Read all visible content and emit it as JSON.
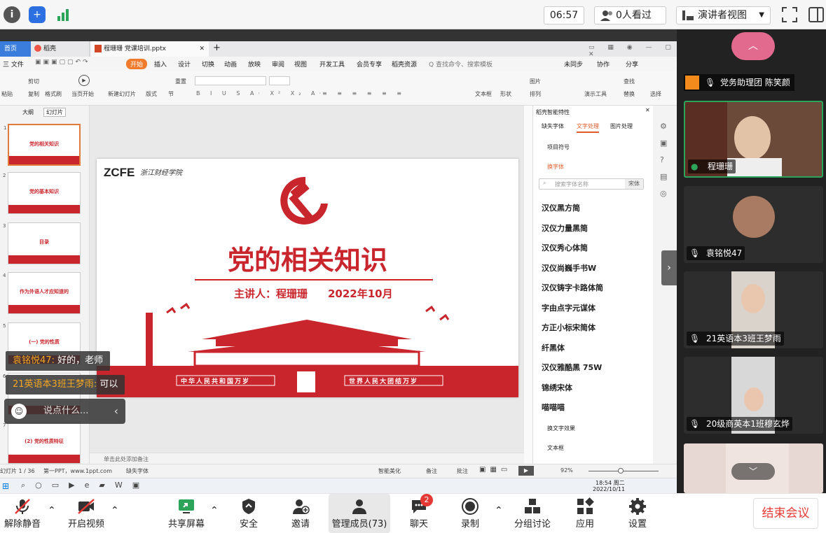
{
  "topbar": {
    "time": "06:57",
    "viewers": "0人看过",
    "view_mode": "演讲者视图"
  },
  "wps": {
    "tabs": [
      "首页",
      "稻壳",
      "程珊珊 党课培训.pptx"
    ],
    "menu": [
      "三 文件",
      "开始",
      "插入",
      "设计",
      "切换",
      "动画",
      "放映",
      "审阅",
      "视图",
      "开发工具",
      "会员专享",
      "稻壳资源",
      "Q 查找命令、搜索模板"
    ],
    "menu_right": [
      "未同步",
      "协作",
      "分享"
    ],
    "ribbon": [
      "粘贴",
      "剪切",
      "复制",
      "格式刷",
      "当页开始",
      "新建幻灯片",
      "版式",
      "节",
      "重置",
      "文本框",
      "形状",
      "图片",
      "排列",
      "演示工具",
      "查找",
      "替换",
      "选择"
    ],
    "thumb_tabs": [
      "大纲",
      "幻灯片"
    ],
    "thumb_titles": [
      "党的相关知识",
      "党的基本知识",
      "目录",
      "作为外语人才应知道的",
      "(一) 党的性质",
      "",
      "(2) 党的性质特征"
    ],
    "notes_placeholder": "单击此处添加备注",
    "status_left": "幻灯片 1 / 36",
    "status_mid": "第一PPT，www.1ppt.com",
    "status_font": "缺失字体",
    "status_right": [
      "智能美化",
      "备注",
      "批注"
    ],
    "zoom": "92%",
    "clock_time": "18:54 周二",
    "clock_date": "2022/10/11"
  },
  "slide": {
    "logo_text": "ZCFE",
    "logo_cn": "浙江财经学院",
    "title": "党的相关知识",
    "speaker": "主讲人：程珊珊",
    "date": "2022年10月",
    "banner_left": "中华人民共和国万岁",
    "banner_right": "世界人民大团结万岁"
  },
  "font_panel": {
    "header": "稻壳智能特性",
    "tabs": [
      "缺失字体",
      "文字处理",
      "图片处理"
    ],
    "section1": "项目符号",
    "section2": "换字体",
    "search_placeholder": "搜索字体名称",
    "search_tag": "宋体",
    "fonts": [
      "汉仪黑方简",
      "汉仪力量黑简",
      "汉仪秀心体简",
      "汉仪尚巍手书W",
      "汉仪铸字卡路体简",
      "字由点字元谋体",
      "方正小标宋简体",
      "纤黑体",
      "汉仪雅酷黑 75W",
      "锦绣宋体",
      "喵喵喵"
    ],
    "section3": "换文字效果",
    "section4": "文本框"
  },
  "chat": {
    "messages": [
      {
        "who": "袁铭悦47:",
        "text": "好的，老师"
      },
      {
        "who": "21英语本3班王梦雨:",
        "text": "可以"
      }
    ],
    "input_placeholder": "说点什么..."
  },
  "participants": [
    {
      "name": "党务助理团 陈笑颜"
    },
    {
      "name": "程珊珊"
    },
    {
      "name": "袁铭悦47"
    },
    {
      "name": "21英语本3班王梦雨"
    },
    {
      "name": "20级商英本1班穆玄烨"
    }
  ],
  "bottombar": {
    "mute": "解除静音",
    "video": "开启视频",
    "share": "共享屏幕",
    "security": "安全",
    "invite": "邀请",
    "members": "管理成员(73)",
    "chat": "聊天",
    "chat_badge": "2",
    "record": "录制",
    "breakout": "分组讨论",
    "apps": "应用",
    "settings": "设置",
    "end": "结束会议"
  },
  "colors": {
    "party_red": "#c9252c",
    "meeting_green": "#2ca55a",
    "end_red": "#e53935"
  }
}
